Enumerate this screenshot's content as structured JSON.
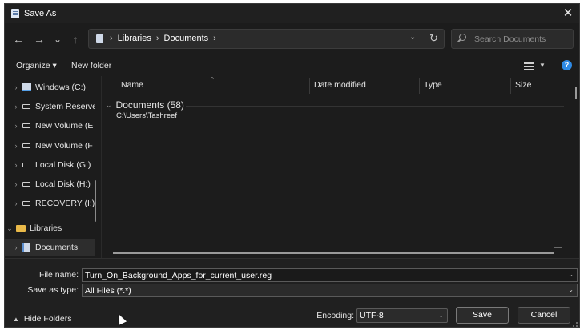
{
  "window": {
    "title": "Save As",
    "close_glyph": "✕"
  },
  "nav": {
    "back_glyph": "←",
    "forward_glyph": "→",
    "recent_glyph": "⌄",
    "up_glyph": "↑"
  },
  "address": {
    "icon": "library-icon",
    "crumbs": [
      "Libraries",
      "Documents"
    ],
    "separator": "›",
    "dropdown_glyph": "⌄",
    "refresh_glyph": "↻"
  },
  "search": {
    "placeholder": "Search Documents",
    "value": ""
  },
  "toolbar": {
    "organize_label": "Organize ▾",
    "new_folder_label": "New folder",
    "view_caret": "▼",
    "help_glyph": "?"
  },
  "sidebar": {
    "items": [
      {
        "label": "Windows (C:)",
        "icon": "windows-drive-icon",
        "chevron": "›"
      },
      {
        "label": "System Reserve",
        "icon": "drive-icon",
        "chevron": "›"
      },
      {
        "label": "New Volume (E",
        "icon": "drive-icon",
        "chevron": "›"
      },
      {
        "label": "New Volume (F",
        "icon": "drive-icon",
        "chevron": "›"
      },
      {
        "label": "Local Disk (G:)",
        "icon": "drive-icon",
        "chevron": "›"
      },
      {
        "label": "Local Disk (H:)",
        "icon": "drive-icon",
        "chevron": "›"
      },
      {
        "label": "RECOVERY (I:)",
        "icon": "drive-icon",
        "chevron": "›"
      },
      {
        "label": "Libraries",
        "icon": "folder-icon",
        "chevron": "⌄"
      },
      {
        "label": "Documents",
        "icon": "library-icon",
        "chevron": "›",
        "selected": true
      }
    ]
  },
  "file_list": {
    "columns": [
      "Name",
      "Date modified",
      "Type",
      "Size"
    ],
    "sort_glyph": "^",
    "group": {
      "title": "Documents (58)",
      "chevron": "⌄",
      "path": "C:\\Users\\Tashreef"
    }
  },
  "form": {
    "file_name_label": "File name:",
    "file_name_value": "Turn_On_Background_Apps_for_current_user.reg",
    "save_as_type_label": "Save as type:",
    "save_as_type_value": "All Files  (*.*)",
    "combo_arrow": "⌄",
    "encoding_label": "Encoding:",
    "encoding_value": "UTF-8"
  },
  "footer": {
    "hide_folders_label": "Hide Folders",
    "hide_chevron": "▲",
    "save_label": "Save",
    "cancel_label": "Cancel"
  },
  "colors": {
    "background": "#1c1c1c",
    "accent": "#2e8ae6",
    "folder": "#e9b949"
  }
}
